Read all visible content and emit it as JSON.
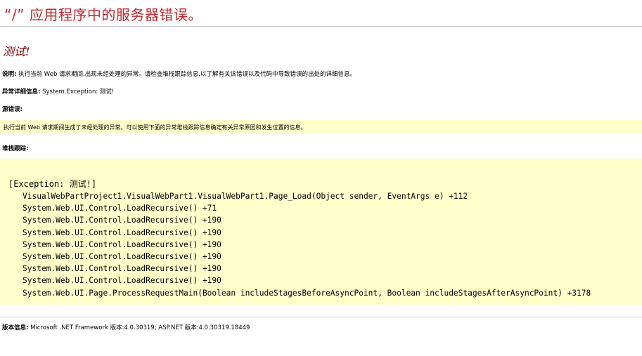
{
  "header": {
    "title": "“/” 应用程序中的服务器错误。"
  },
  "error": {
    "message": "测试!",
    "description_label": "说明:",
    "description": "执行当前 Web 请求期间,出现未经处理的异常。请检查堆栈跟踪信息,以了解有关该错误以及代码中导致错误的出处的详细信息。",
    "exception_details_label": "异常详细信息:",
    "exception_details": "System.Exception: 测试!",
    "source_error_label": "源错误:",
    "source_error_text": "执行当前 Web 请求期间生成了未经处理的异常。可以使用下面的异常堆栈跟踪信息确定有关异常原因和发生位置的信息。",
    "stack_trace_label": "堆栈跟踪:"
  },
  "stack_trace": {
    "exception": "[Exception: 测试!]",
    "frames": [
      "VisualWebPartProject1.VisualWebPart1.VisualWebPart1.Page_Load(Object sender, EventArgs e) +112",
      "System.Web.UI.Control.LoadRecursive() +71",
      "System.Web.UI.Control.LoadRecursive() +190",
      "System.Web.UI.Control.LoadRecursive() +190",
      "System.Web.UI.Control.LoadRecursive() +190",
      "System.Web.UI.Control.LoadRecursive() +190",
      "System.Web.UI.Control.LoadRecursive() +190",
      "System.Web.UI.Control.LoadRecursive() +190",
      "System.Web.UI.Page.ProcessRequestMain(Boolean includeStagesBeforeAsyncPoint, Boolean includeStagesAfterAsyncPoint) +3178"
    ]
  },
  "version": {
    "label": "版本信息:",
    "text": "Microsoft .NET Framework 版本:4.0.30319; ASP.NET 版本:4.0.30319.18449"
  },
  "colors": {
    "title": "#c0282d",
    "message": "#800000",
    "highlight_box": "#ffffcc",
    "divider": "#c8c8c8"
  }
}
